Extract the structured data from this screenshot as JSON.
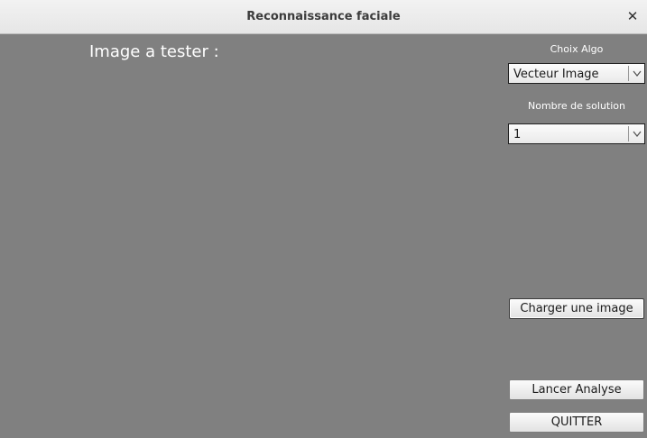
{
  "window": {
    "title": "Reconnaissance faciale",
    "close_icon": "close-icon"
  },
  "main": {
    "image_label": "Image a tester :"
  },
  "sidebar": {
    "algo_label": "Choix Algo",
    "algo_value": "Vecteur Image",
    "solutions_label": "Nombre de solution",
    "solutions_value": "1",
    "load_button": "Charger une image",
    "analyze_button": "Lancer Analyse",
    "quit_button": "QUITTER"
  },
  "colors": {
    "background": "#808080",
    "text": "#ffffff"
  }
}
